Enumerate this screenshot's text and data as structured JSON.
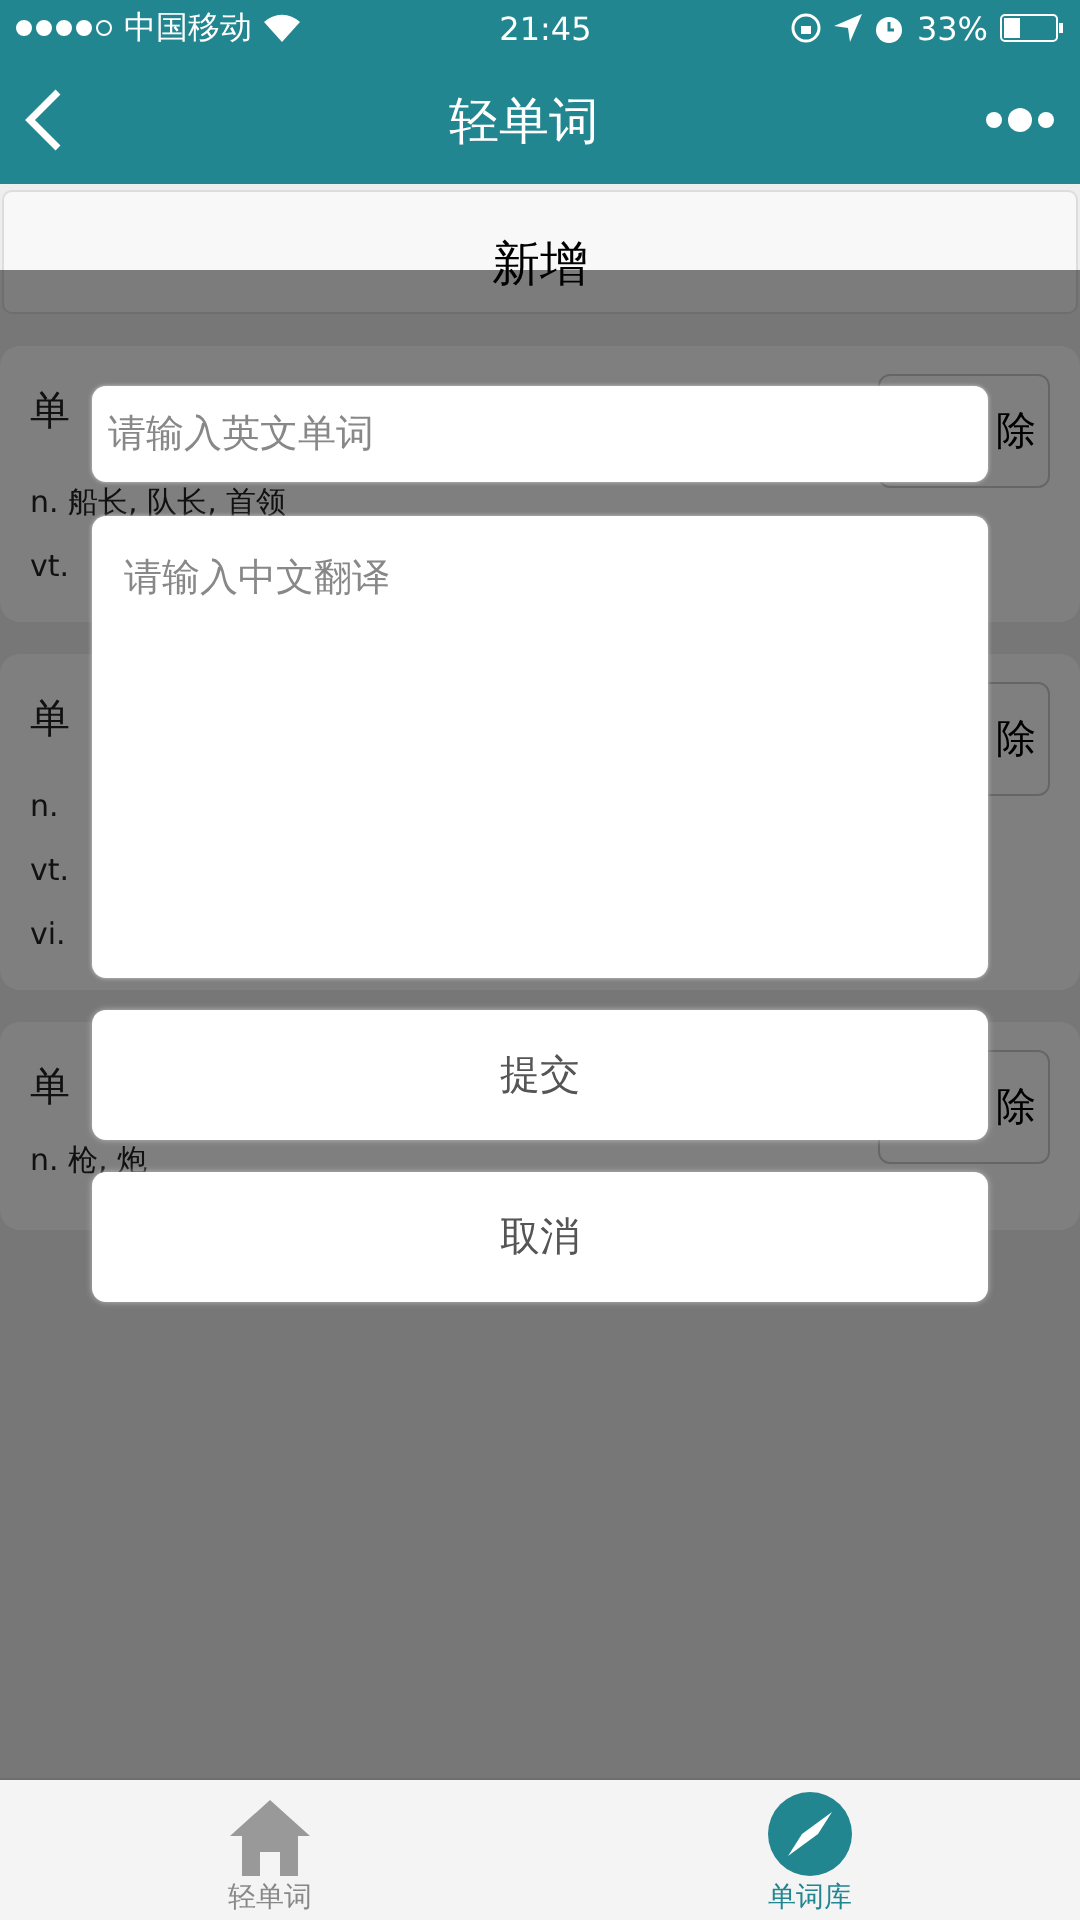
{
  "status_bar": {
    "carrier": "中国移动",
    "time": "21:45",
    "battery": "33%"
  },
  "nav": {
    "title": "轻单词"
  },
  "add_button": {
    "label": "新增"
  },
  "cards": [
    {
      "word_label": "单",
      "lines": [
        "n. 船长, 队长, 首领",
        "vt."
      ],
      "delete_label": "除"
    },
    {
      "word_label": "单",
      "lines": [
        "n.",
        "vt.",
        "vi."
      ],
      "delete_label": "除"
    },
    {
      "word_label": "单",
      "lines": [
        "n. 枪, 炮"
      ],
      "delete_label": "除"
    }
  ],
  "modal": {
    "word_field": {
      "placeholder": "请输入英文单词"
    },
    "translation_field": {
      "placeholder": "请输入中文翻译"
    },
    "buttons": [
      {
        "label": "提交"
      },
      {
        "label": "取消"
      }
    ]
  },
  "tab_bar": [
    {
      "label": "轻单词",
      "selected": false
    },
    {
      "label": "单词库",
      "selected": true
    }
  ]
}
